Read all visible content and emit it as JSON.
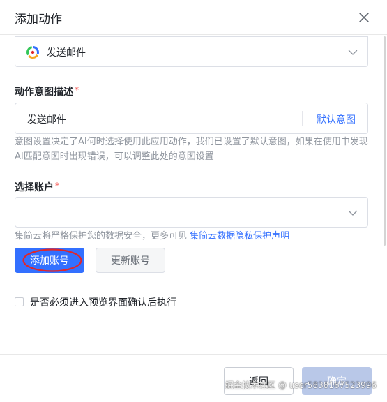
{
  "dialog": {
    "title": "添加动作"
  },
  "action": {
    "selected": "发送邮件",
    "app_icon": "app-logo-icon"
  },
  "intent": {
    "label": "动作意图描述",
    "required_mark": "*",
    "value": "发送邮件",
    "default_link": "默认意图",
    "help": "意图设置决定了AI何时选择使用此应用动作，我们已设置了默认意图，如果在使用中发现AI匹配意图时出现错误，可以调整此处的意图设置"
  },
  "account": {
    "label": "选择账户",
    "required_mark": "*",
    "value": "",
    "help_prefix": "集简云将严格保护您的数据安全，更多可见 ",
    "help_link": "集简云数据隐私保护声明",
    "add_button": "添加账号",
    "refresh_button": "更新账号"
  },
  "preview": {
    "label": "是否必须进入预览界面确认后执行",
    "checked": false
  },
  "footer": {
    "back_button": "返回",
    "confirm_button": "确定"
  },
  "watermark": "掘金技术社区 @ user5838167523996",
  "colors": {
    "primary": "#3370ff",
    "required": "#f54a45",
    "annotation": "#e0262b"
  }
}
